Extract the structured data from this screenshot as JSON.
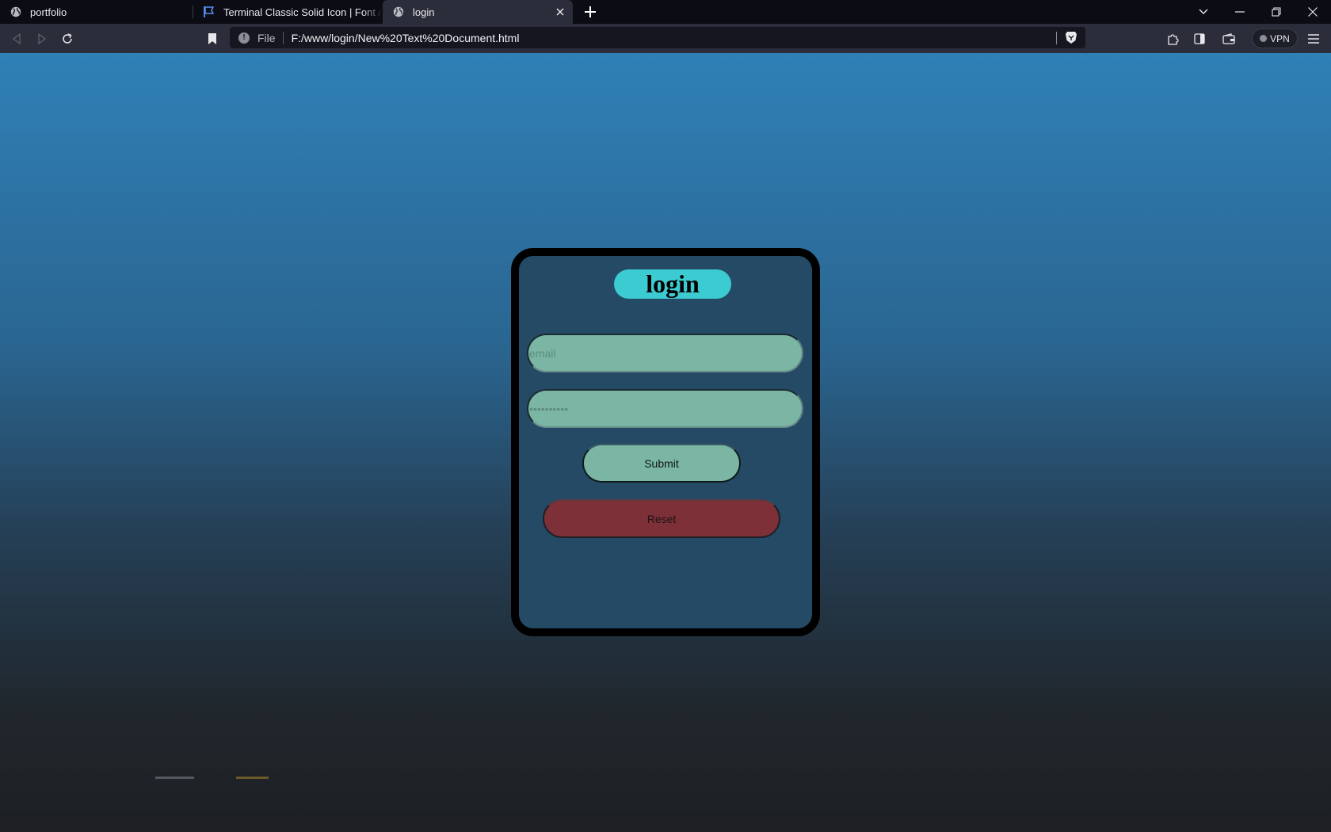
{
  "browser": {
    "tabs": [
      {
        "title": "portfolio",
        "icon": "globe-icon",
        "active": false
      },
      {
        "title": "Terminal Classic Solid Icon | Font Awesome",
        "icon": "font-awesome-flag-icon",
        "active": false
      },
      {
        "title": "login",
        "icon": "globe-icon",
        "active": true
      }
    ],
    "new_tab_label": "+",
    "address": {
      "scheme_label": "File",
      "url": "F:/www/login/New%20Text%20Document.html"
    },
    "vpn_label": "VPN"
  },
  "page": {
    "title": "login",
    "email_placeholder": "email",
    "password_placeholder": "••••••••••",
    "submit_label": "Submit",
    "reset_label": "Reset"
  },
  "colors": {
    "title_pill": "#3ccbd0",
    "input_fill": "#7bb5a4",
    "reset_fill": "#7d3038",
    "card_fill": "#254a65",
    "card_border": "#000000",
    "bg_top": "#2f80b7",
    "bg_bottom": "#1e2023"
  }
}
